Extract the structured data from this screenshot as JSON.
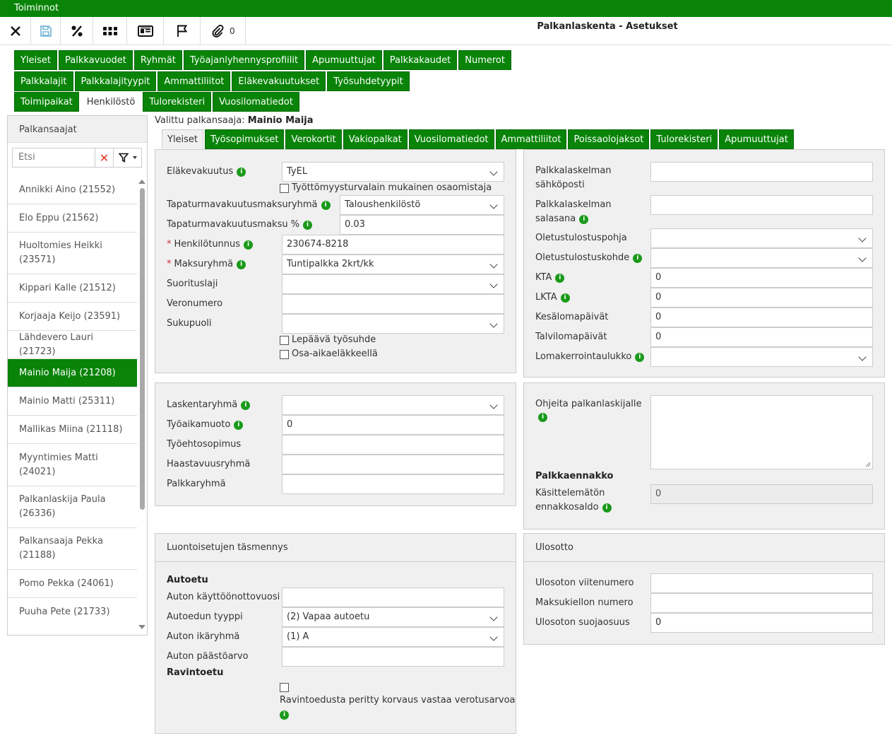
{
  "topbar": {
    "menu": "Toiminnot"
  },
  "toolbar": {
    "title": "Palkanlaskenta - Asetukset",
    "attachment_count": "0"
  },
  "nav": {
    "row1": [
      "Yleiset",
      "Palkkavuodet",
      "Ryhmät",
      "Työajanlyhennysprofiilit",
      "Apumuuttujat",
      "Palkkakaudet",
      "Numerot"
    ],
    "row2": [
      "Palkkalajit",
      "Palkkalajityypit",
      "Ammattiliitot",
      "Eläkevakuutukset",
      "Työsuhdetyypit"
    ],
    "row3": [
      "Toimipaikat",
      "Henkilöstö",
      "Tulorekisteri",
      "Vuosilomatiedot"
    ],
    "active": "Henkilöstö"
  },
  "left": {
    "title": "Palkansaajat",
    "search_placeholder": "Etsi",
    "employees": [
      "Annikki Aino (21552)",
      "Elo Eppu (21562)",
      "Huoltomies Heikki (23571)",
      "Kippari Kalle (21512)",
      "Korjaaja Keijo (23591)",
      "Lähdevero Lauri (21723)",
      "Mainio Maija (21208)",
      "Mainio Matti (25311)",
      "Mallikas Miina (21118)",
      "Myyntimies Matti (24021)",
      "Palkanlaskija Paula (26336)",
      "Palkansaaja Pekka (21188)",
      "Pomo Pekka (24061)",
      "Puuha Pete (21733)"
    ],
    "selected": "Mainio Maija (21208)"
  },
  "selected_employee": {
    "label": "Valittu palkansaaja:",
    "name": "Mainio Maija"
  },
  "subtabs": [
    "Yleiset",
    "Työsopimukset",
    "Verokortit",
    "Vakiopalkat",
    "Vuosilomatiedot",
    "Ammattiliitot",
    "Poissaolojaksot",
    "Tulorekisteri",
    "Apumuuttujat"
  ],
  "general": {
    "elakevakuutus": {
      "label": "Eläkevakuutus",
      "value": "TyEL"
    },
    "tyottomyys_cb": "Työttömyysturvalain mukainen osaomistaja",
    "tapaturmaryhma": {
      "label": "Tapaturmavakuutusmaksuryhmä",
      "value": "Taloushenkilöstö"
    },
    "tapaturmamaksu": {
      "label": "Tapaturmavakuutusmaksu %",
      "value": "0.03"
    },
    "henkilotunnus": {
      "label": "Henkilötunnus",
      "value": "230674-8218"
    },
    "maksuryhma": {
      "label": "Maksuryhmä",
      "value": "Tuntipalkka 2krt/kk"
    },
    "suorituslaji": {
      "label": "Suorituslaji",
      "value": ""
    },
    "veronumero": {
      "label": "Veronumero",
      "value": ""
    },
    "sukupuoli": {
      "label": "Sukupuoli",
      "value": ""
    },
    "lepaava_cb": "Lepäävä työsuhde",
    "osa_aika_cb": "Osa-aikaeläkkeellä"
  },
  "group": {
    "laskentaryhma": {
      "label": "Laskentaryhmä",
      "value": ""
    },
    "tyoaikamuoto": {
      "label": "Työaikamuoto",
      "value": "0"
    },
    "tyoehtosopimus": {
      "label": "Työehtosopimus",
      "value": ""
    },
    "haastavuusryhma": {
      "label": "Haastavuusryhmä",
      "value": ""
    },
    "palkkaryhma": {
      "label": "Palkkaryhmä",
      "value": ""
    }
  },
  "benefits": {
    "title": "Luontoisetujen täsmennys",
    "autoetu": "Autoetu",
    "kayttoonotto": {
      "label": "Auton käyttöönottovuosi",
      "value": ""
    },
    "tyyppi": {
      "label": "Autoedun tyyppi",
      "value": "(2) Vapaa autoetu"
    },
    "ikaryhma": {
      "label": "Auton ikäryhmä",
      "value": "(1) A"
    },
    "paastoarvo": {
      "label": "Auton päästöarvo",
      "value": ""
    },
    "ravintoetu": "Ravintoetu",
    "ravinto_cb": "Ravintoedusta peritty korvaus vastaa verotusarvoa"
  },
  "right": {
    "sahkoposti": {
      "label1": "Palkkalaskelman",
      "label2": "sähköposti",
      "value": ""
    },
    "salasana": {
      "label1": "Palkkalaskelman",
      "label2": "salasana",
      "value": ""
    },
    "tulostuspohja": {
      "label": "Oletustulostuspohja",
      "value": ""
    },
    "tulostuskohde": {
      "label": "Oletustulostuskohde",
      "value": ""
    },
    "kta": {
      "label": "KTA",
      "value": "0"
    },
    "lkta": {
      "label": "LKTA",
      "value": "0"
    },
    "kesaloma": {
      "label": "Kesälomapäivät",
      "value": "0"
    },
    "talviloma": {
      "label": "Talvilomapäivät",
      "value": "0"
    },
    "lomakerroin": {
      "label": "Lomakerrointaulukko",
      "value": ""
    }
  },
  "notes": {
    "ohjeita": "Ohjeita palkanlaskijalle",
    "palkkaennakko": "Palkkaennakko",
    "kasittelematon1": "Käsittelemätön",
    "kasittelematon2": "ennakkosaldo",
    "saldo": "0"
  },
  "ulosotto": {
    "title": "Ulosotto",
    "viitenumero": {
      "label": "Ulosoton viitenumero",
      "value": ""
    },
    "maksukielto": {
      "label": "Maksukiellon numero",
      "value": ""
    },
    "suojaosuus": {
      "label": "Ulosoton suojaosuus",
      "value": "0"
    }
  }
}
